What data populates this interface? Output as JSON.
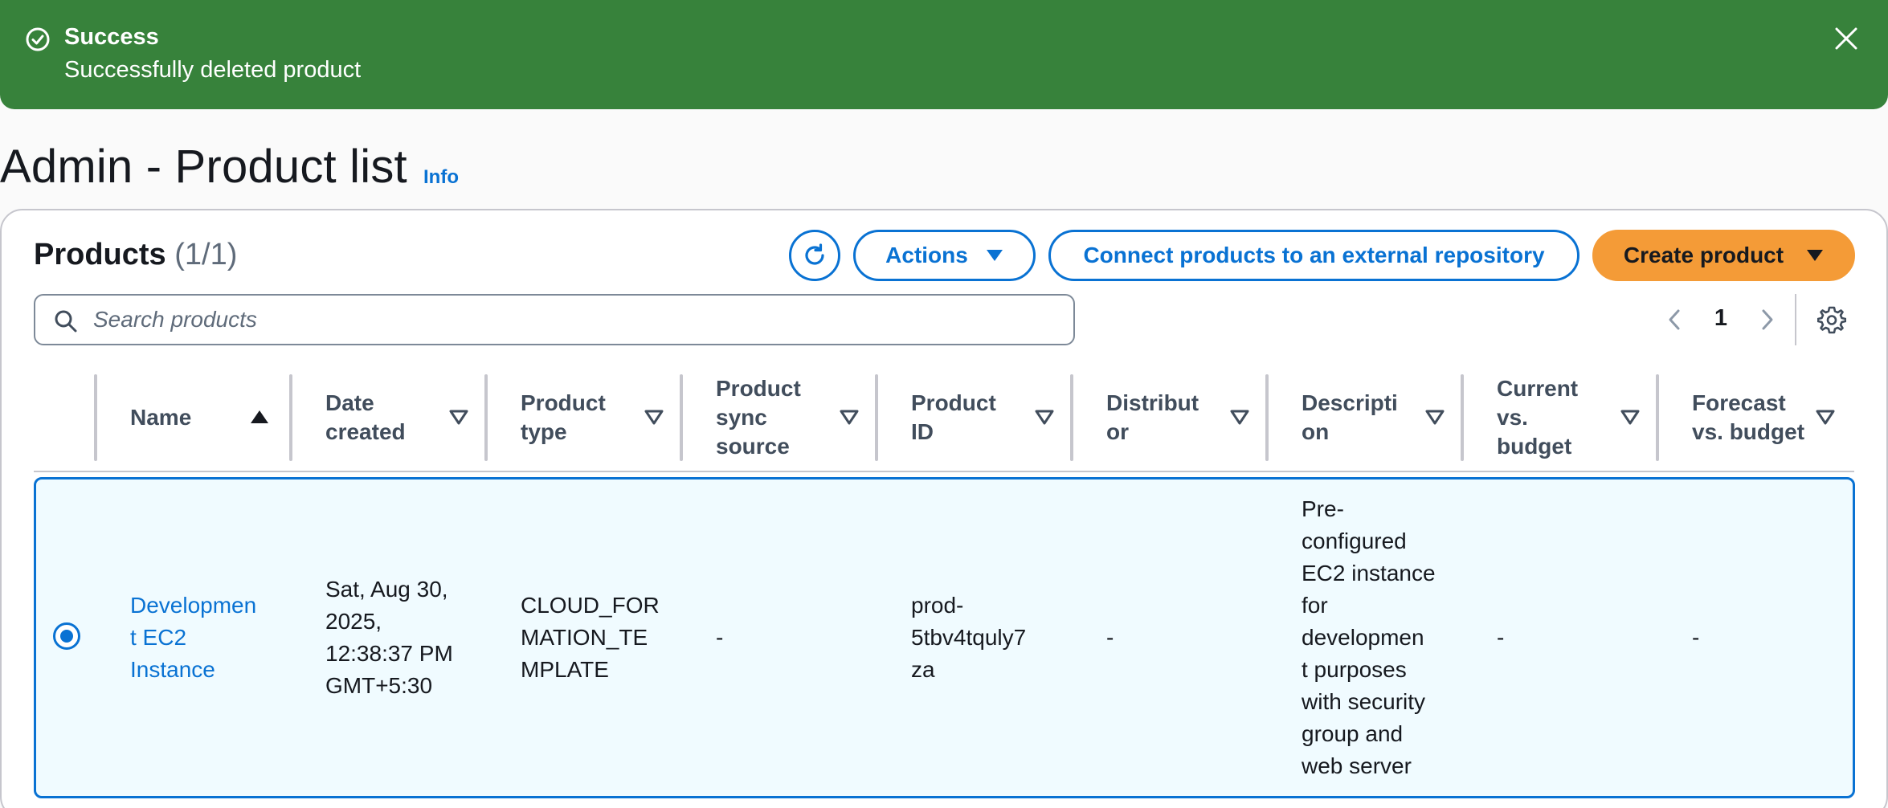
{
  "flash": {
    "title": "Success",
    "message": "Successfully deleted product",
    "color": "#37823b"
  },
  "page": {
    "title": "Admin - Product list",
    "info_link": "Info"
  },
  "products": {
    "heading": "Products",
    "count": "(1/1)",
    "actions_label": "Actions",
    "connect_label": "Connect products to an external repository",
    "create_label": "Create product",
    "search_placeholder": "Search products",
    "current_page": "1"
  },
  "table": {
    "columns": [
      {
        "label": "Name",
        "lines": [
          "Name"
        ],
        "sort": "ascending"
      },
      {
        "label": "Date created",
        "lines": [
          "Date",
          "created"
        ],
        "sort": "none"
      },
      {
        "label": "Product type",
        "lines": [
          "Product",
          "type"
        ],
        "sort": "none"
      },
      {
        "label": "Product sync source",
        "lines": [
          "Product",
          "sync",
          "source"
        ],
        "sort": "none"
      },
      {
        "label": "Product ID",
        "lines": [
          "Product",
          "ID"
        ],
        "sort": "none"
      },
      {
        "label": "Distributor",
        "lines": [
          "Distribut",
          "or"
        ],
        "sort": "none"
      },
      {
        "label": "Description",
        "lines": [
          "Descripti",
          "on"
        ],
        "sort": "none"
      },
      {
        "label": "Current vs. budget",
        "lines": [
          "Current",
          "vs.",
          "budget"
        ],
        "sort": "none"
      },
      {
        "label": "Forecast vs. budget",
        "lines": [
          "Forecast",
          "vs. budget"
        ],
        "sort": "none"
      }
    ],
    "rows": [
      {
        "selected": true,
        "name": [
          "Developmen",
          "t EC2",
          "Instance"
        ],
        "date_created": [
          "Sat, Aug 30,",
          "2025,",
          "12:38:37 PM",
          "GMT+5:30"
        ],
        "product_type": [
          "CLOUD_FOR",
          "MATION_TE",
          "MPLATE"
        ],
        "sync_source": [
          "-"
        ],
        "product_id": [
          "prod-",
          "5tbv4tquly7",
          "za"
        ],
        "distributor": [
          "-"
        ],
        "description": [
          "Pre-",
          "configured",
          "EC2 instance",
          "for",
          "developmen",
          "t purposes",
          "with security",
          "group and",
          "web server"
        ],
        "current_vs_budget": [
          "-"
        ],
        "forecast_vs_budget": [
          "-"
        ]
      }
    ]
  },
  "colors": {
    "accent": "#0972d3",
    "primary_button": "#f49b37",
    "success": "#37823b",
    "selected_row_bg": "#f0fbff"
  }
}
